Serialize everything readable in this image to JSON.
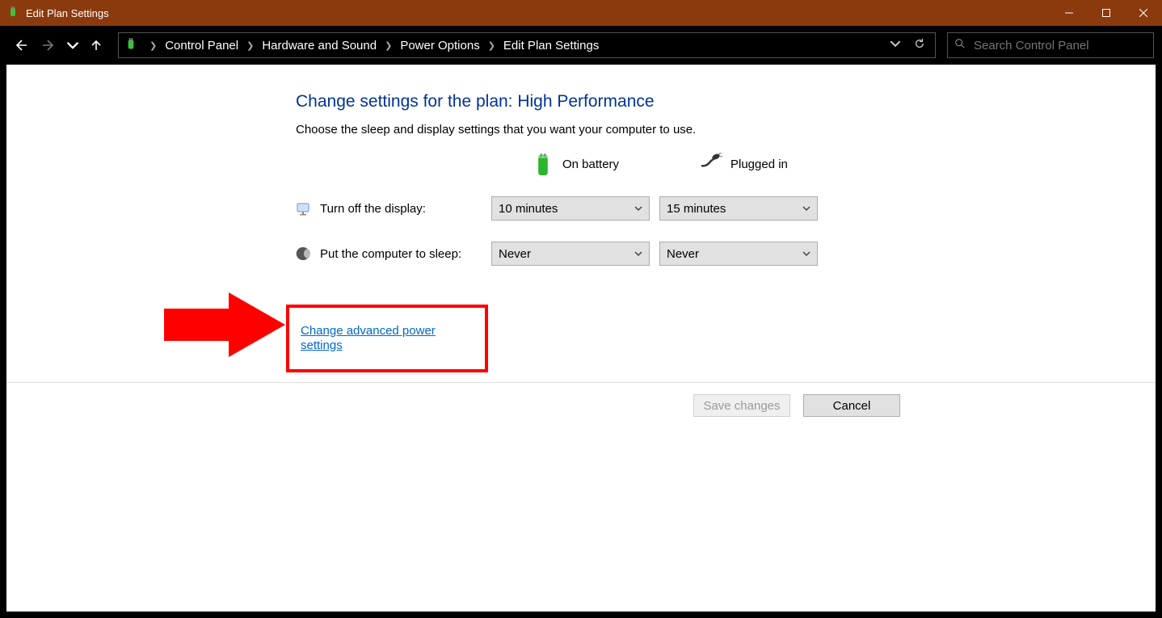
{
  "window": {
    "title": "Edit Plan Settings"
  },
  "breadcrumb": {
    "items": [
      "Control Panel",
      "Hardware and Sound",
      "Power Options",
      "Edit Plan Settings"
    ]
  },
  "search": {
    "placeholder": "Search Control Panel"
  },
  "page": {
    "heading": "Change settings for the plan: High Performance",
    "subheading": "Choose the sleep and display settings that you want your computer to use."
  },
  "columns": {
    "battery": "On battery",
    "plugged": "Plugged in"
  },
  "rows": {
    "display": {
      "label": "Turn off the display:",
      "battery_value": "10 minutes",
      "plugged_value": "15 minutes"
    },
    "sleep": {
      "label": "Put the computer to sleep:",
      "battery_value": "Never",
      "plugged_value": "Never"
    }
  },
  "link": {
    "advanced": "Change advanced power settings"
  },
  "buttons": {
    "save": "Save changes",
    "cancel": "Cancel"
  }
}
